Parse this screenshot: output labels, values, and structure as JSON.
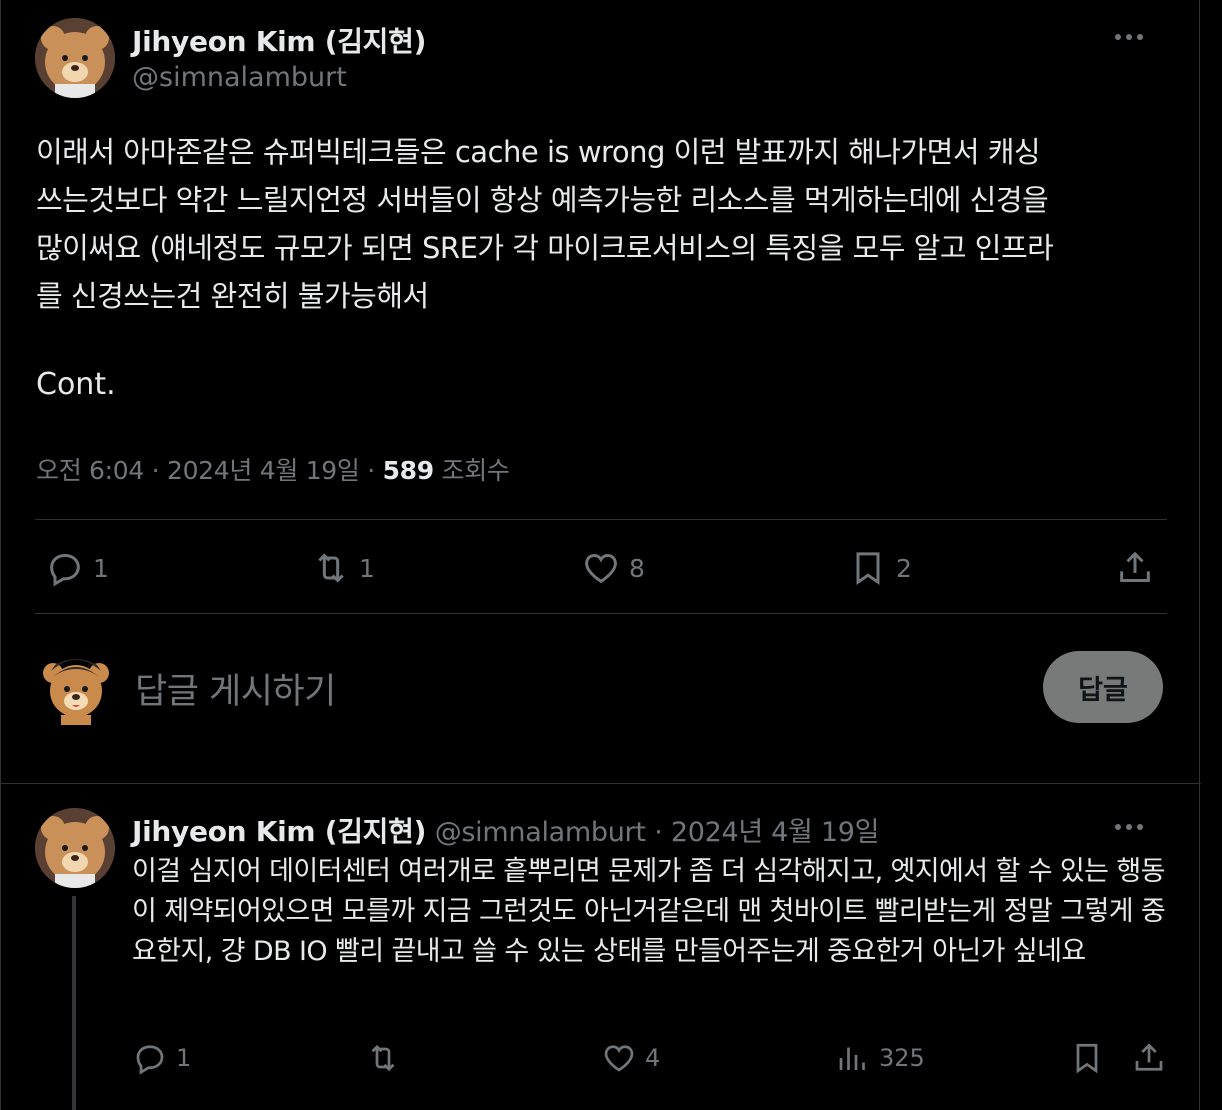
{
  "tweet": {
    "author_name": "Jihyeon Kim (김지현)",
    "author_handle": "@simnalamburt",
    "text": "이래서 아마존같은 슈퍼빅테크들은 cache is wrong 이런 발표까지 해나가면서 캐싱\n쓰는것보다 약간 느릴지언정 서버들이 항상 예측가능한 리소스를 먹게하는데에 신경을\n많이써요 (얘네정도 규모가 되면 SRE가 각 마이크로서비스의 특징을 모두 알고 인프라\n를 신경쓰는건 완전히 불가능해서",
    "continuation": "Cont.",
    "time": "오전 6:04",
    "date": "2024년 4월 19일",
    "views_count": "589",
    "views_label": "조회수",
    "separator": "·",
    "actions": {
      "reply_count": "1",
      "retweet_count": "1",
      "like_count": "8",
      "bookmark_count": "2"
    }
  },
  "compose": {
    "placeholder": "답글 게시하기",
    "button_label": "답글"
  },
  "reply": {
    "author_name": "Jihyeon Kim (김지현)",
    "author_handle": "@simnalamburt",
    "date": "· 2024년 4월 19일",
    "text": "이걸 심지어 데이터센터 여러개로 흩뿌리면 문제가 좀 더 심각해지고, 엣지에서 할 수 있는 행동이 제약되어있으면 모를까 지금 그런것도 아닌거같은데 맨 첫바이트 빨리받는게 정말 그렇게 중요한지, 걍 DB IO 빨리 끝내고 쓸 수 있는 상태를 만들어주는게 중요한거 아닌가 싶네요",
    "actions": {
      "reply_count": "1",
      "like_count": "4",
      "views_count": "325"
    }
  },
  "icons": [
    "more-icon",
    "reply-icon",
    "retweet-icon",
    "like-icon",
    "bookmark-icon",
    "share-icon",
    "views-icon"
  ],
  "colors": {
    "background": "#000000",
    "text": "#e7e9ea",
    "muted": "#71767b",
    "border": "#2f3336",
    "reply_button_bg": "#787a7a"
  }
}
